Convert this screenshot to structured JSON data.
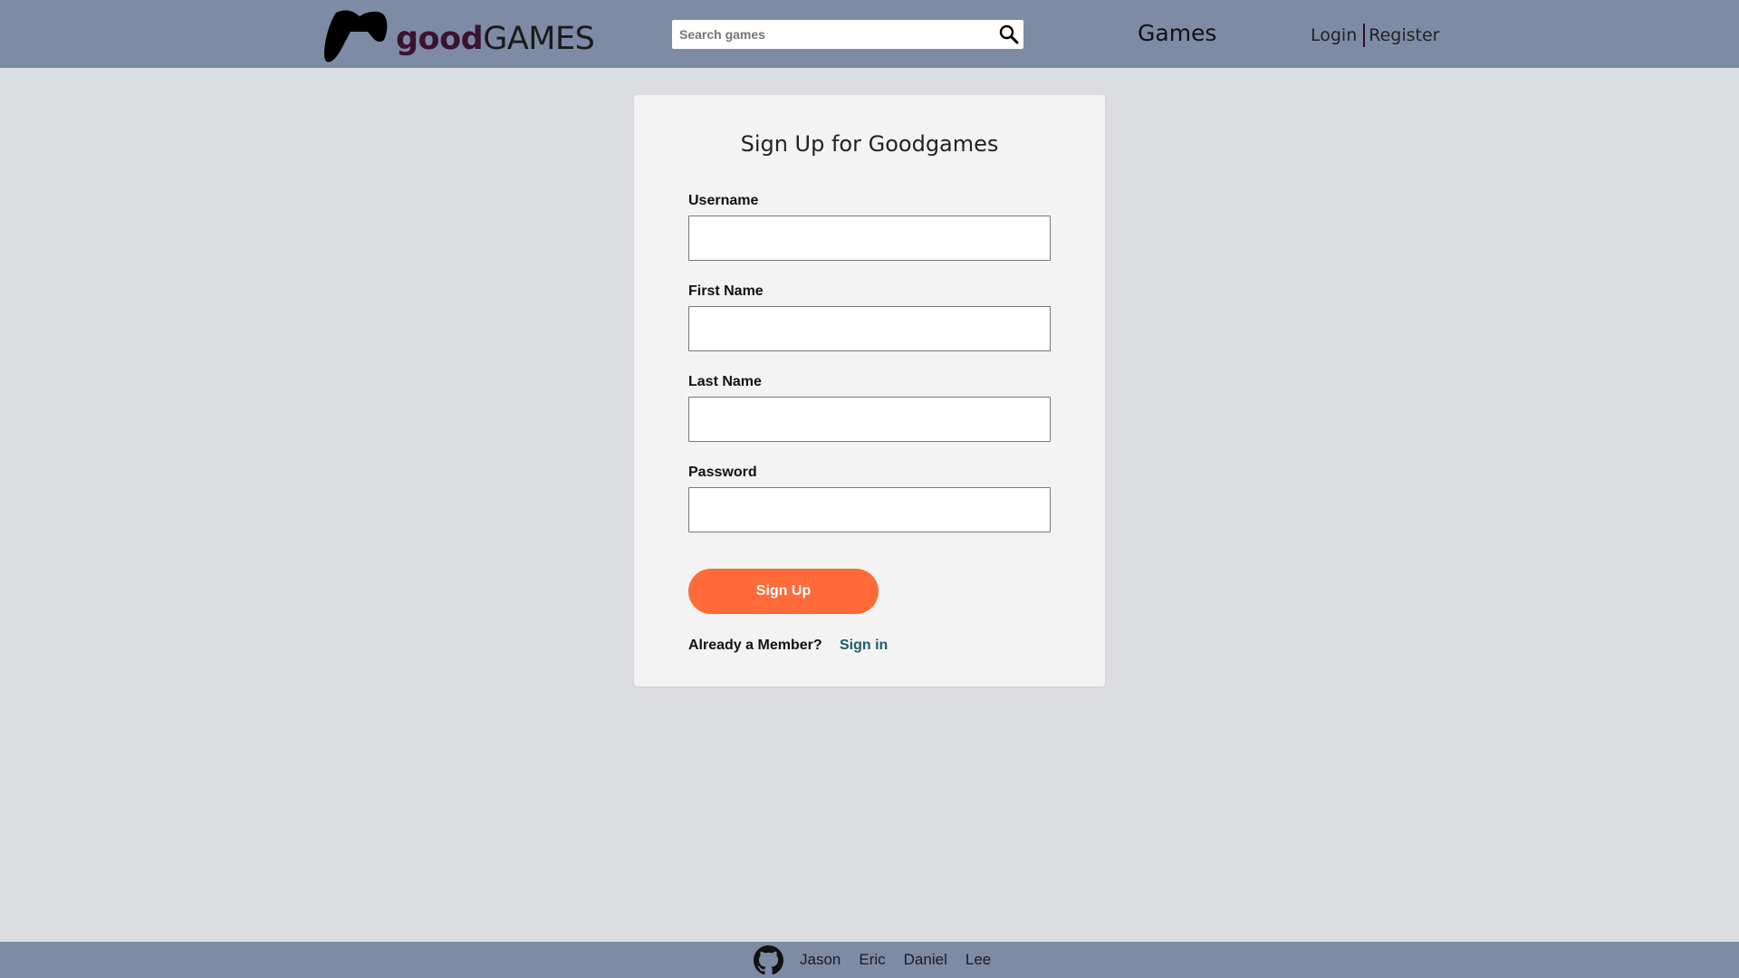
{
  "header": {
    "logo_good": "good",
    "logo_games": "GAMES",
    "search_placeholder": "Search games",
    "nav_games": "Games",
    "login": "Login",
    "register": "Register"
  },
  "form": {
    "title": "Sign Up for Goodgames",
    "fields": [
      {
        "label": "Username",
        "value": ""
      },
      {
        "label": "First Name",
        "value": ""
      },
      {
        "label": "Last Name",
        "value": ""
      },
      {
        "label": "Password",
        "value": ""
      }
    ],
    "submit_label": "Sign Up",
    "member_prompt": "Already a Member?",
    "signin_label": "Sign in"
  },
  "footer": {
    "links": [
      "Jason",
      "Eric",
      "Daniel",
      "Lee"
    ]
  },
  "colors": {
    "header_bg": "#7e8ba5",
    "page_bg": "#dcdde1",
    "card_bg": "#f3f3f3",
    "accent_button": "#ff6a38",
    "link": "#1d5e68",
    "logo_good": "#3a1330"
  },
  "icons": [
    "gamepad-logo-icon",
    "search-icon",
    "github-icon"
  ]
}
